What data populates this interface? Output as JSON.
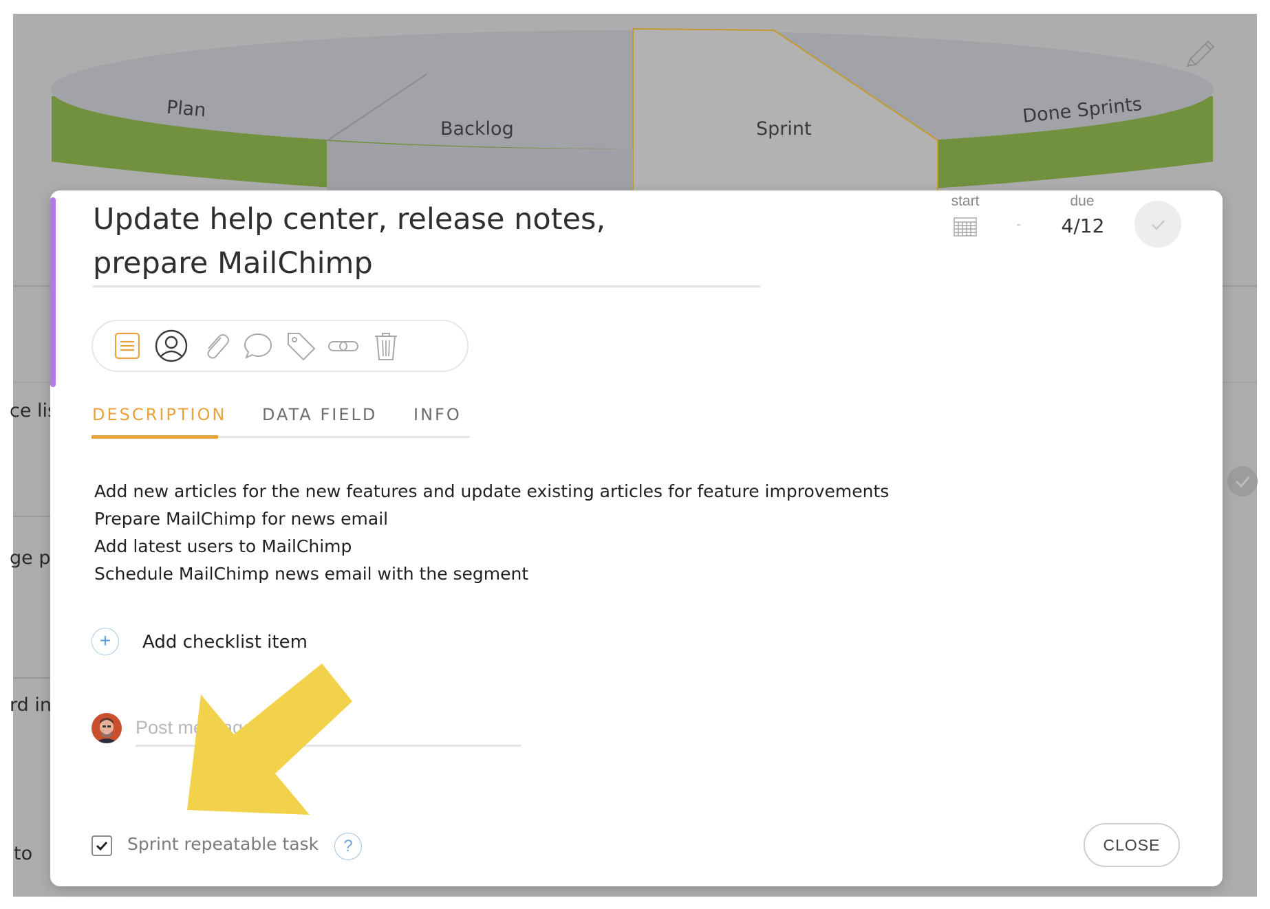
{
  "background": {
    "board_columns": [
      "Plan",
      "Backlog",
      "Sprint",
      "Done Sprints"
    ],
    "edit_icon": "pencil-icon",
    "partial_task_texts": [
      "ce list",
      "ge pu",
      "rd in",
      "to"
    ]
  },
  "task": {
    "title": "Update help center, release notes, prepare MailChimp",
    "accent_color": "#b57ae8",
    "start_label": "start",
    "start_value_icon": "calendar-icon",
    "date_separator": "-",
    "due_label": "due",
    "due_value": "4/12",
    "complete_icon": "checkmark-icon"
  },
  "toolbar": {
    "icons": [
      "description-icon",
      "user-icon",
      "paperclip-icon",
      "comment-icon",
      "tag-icon",
      "link-icon",
      "trash-icon"
    ],
    "active_color": "#e9a23b"
  },
  "tabs": [
    {
      "label": "DESCRIPTION",
      "active": true
    },
    {
      "label": "DATA FIELD",
      "active": false
    },
    {
      "label": "INFO",
      "active": false
    }
  ],
  "description": {
    "lines": [
      "Add new articles for the new features and update existing articles for feature improvements",
      "Prepare MailChimp for news email",
      "Add latest users to MailChimp",
      "Schedule MailChimp news email with the segment"
    ]
  },
  "checklist": {
    "add_label": "Add checklist item"
  },
  "comments": {
    "placeholder": "Post message"
  },
  "footer": {
    "repeatable_label": "Sprint repeatable task",
    "repeatable_checked": true,
    "help_symbol": "?",
    "close_label": "CLOSE"
  },
  "annotation": {
    "arrow_color": "#f2d24a"
  }
}
